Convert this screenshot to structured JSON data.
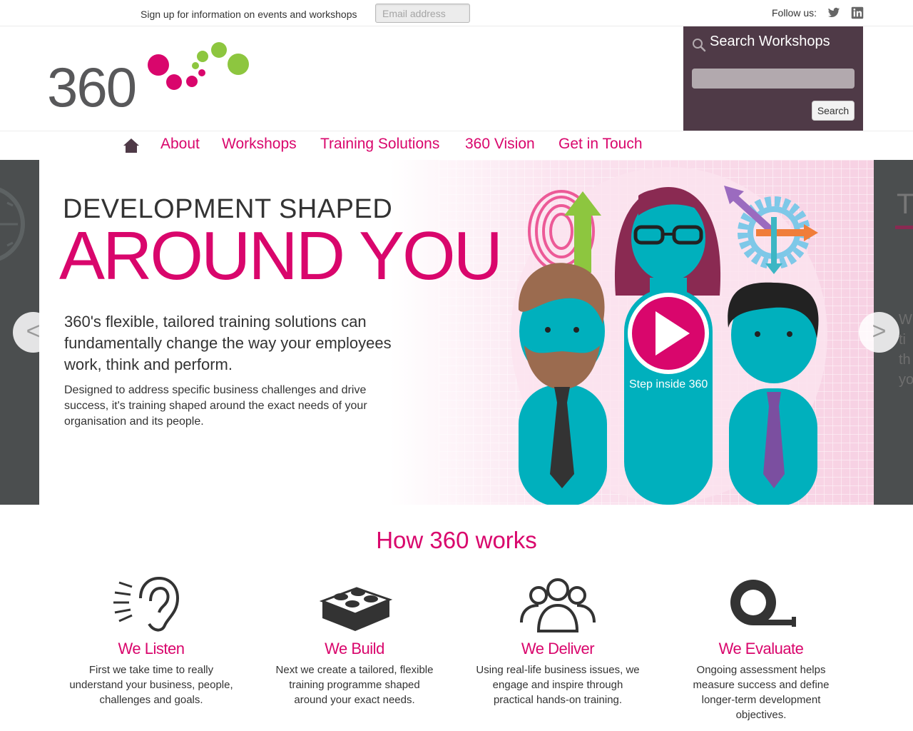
{
  "topbar": {
    "signup_text": "Sign up for information on events and workshops",
    "email_placeholder": "Email address",
    "follow_label": "Follow us:"
  },
  "search": {
    "title": "Search Workshops",
    "button_label": "Search"
  },
  "nav": {
    "items": [
      "About",
      "Workshops",
      "Training Solutions",
      "360 Vision",
      "Get in Touch"
    ]
  },
  "hero": {
    "line1": "DEVELOPMENT SHAPED",
    "line2": "AROUND YOU",
    "lead": "360's flexible, tailored training solutions can fundamentally change the way your employees work, think and perform.",
    "body": "Designed to address specific business challenges and drive success, it's training shaped around the exact needs of your organisation and its people.",
    "play_caption": "Step inside 360",
    "prev_label": "<",
    "next_label": ">"
  },
  "how": {
    "title": "How 360 works",
    "steps": [
      {
        "title": "We Listen",
        "text": "First we take time to really understand your business, people, challenges and goals.",
        "icon": "ear-icon"
      },
      {
        "title": "We Build",
        "text": "Next we create a tailored, flexible training programme shaped around your exact needs.",
        "icon": "lego-brick-icon"
      },
      {
        "title": "We Deliver",
        "text": "Using real-life business issues, we engage and inspire through practical hands-on training.",
        "icon": "people-group-icon"
      },
      {
        "title": "We Evaluate",
        "text": "Ongoing assessment helps measure success and define longer-term development objectives.",
        "icon": "tape-measure-icon"
      }
    ]
  },
  "colors": {
    "brand_pink": "#d9066c",
    "brand_green": "#8dc63f",
    "search_panel": "#4f3a47",
    "figure_teal": "#00b0bd"
  }
}
